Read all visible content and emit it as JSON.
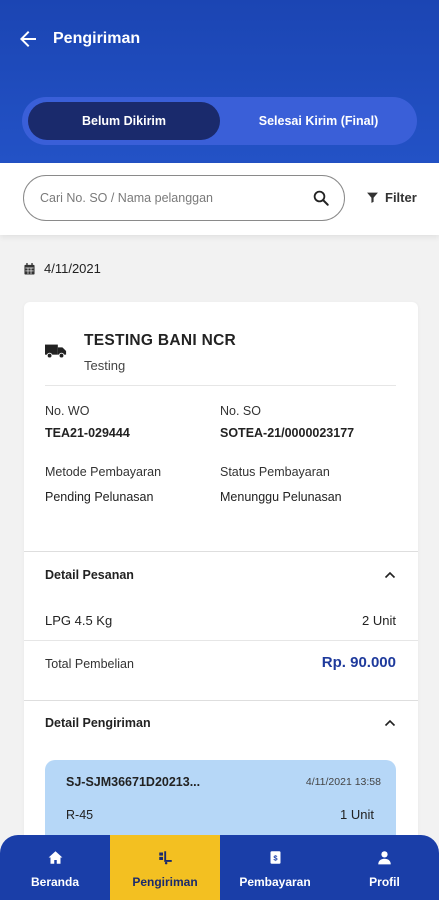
{
  "header": {
    "title": "Pengiriman",
    "tabs": [
      {
        "label": "Belum Dikirim",
        "active": true
      },
      {
        "label": "Selesai Kirim (Final)",
        "active": false
      }
    ]
  },
  "search": {
    "placeholder": "Cari No. SO / Nama pelanggan",
    "filter_label": "Filter"
  },
  "date": "4/11/2021",
  "order": {
    "customer_name": "TESTING BANI NCR",
    "customer_sub": "Testing",
    "no_wo_label": "No. WO",
    "no_wo": "TEA21-029444",
    "no_so_label": "No. SO",
    "no_so": "SOTEA-21/0000023177",
    "payment_method_label": "Metode Pembayaran",
    "payment_method": "Pending Pelunasan",
    "payment_status_label": "Status Pembayaran",
    "payment_status": "Menunggu Pelunasan"
  },
  "order_detail": {
    "title": "Detail Pesanan",
    "item_name": "LPG 4.5 Kg",
    "item_qty": "2 Unit",
    "total_label": "Total Pembelian",
    "total_value": "Rp. 90.000"
  },
  "shipping_detail": {
    "title": "Detail Pengiriman",
    "code": "SJ-SJM36671D20213...",
    "datetime": "4/11/2021 13:58",
    "name": "R-45",
    "qty": "1 Unit"
  },
  "bottom_nav": [
    {
      "label": "Beranda",
      "icon": "home-icon",
      "active": false
    },
    {
      "label": "Pengiriman",
      "icon": "delivery-icon",
      "active": true
    },
    {
      "label": "Pembayaran",
      "icon": "payment-icon",
      "active": false
    },
    {
      "label": "Profil",
      "icon": "profile-icon",
      "active": false
    }
  ],
  "colors": {
    "primary": "#1b45b3",
    "accent": "#f3c021",
    "tab_active": "#1a2a6c",
    "total_text": "#1e3a9c",
    "shipment_card": "#b6d7f7"
  }
}
